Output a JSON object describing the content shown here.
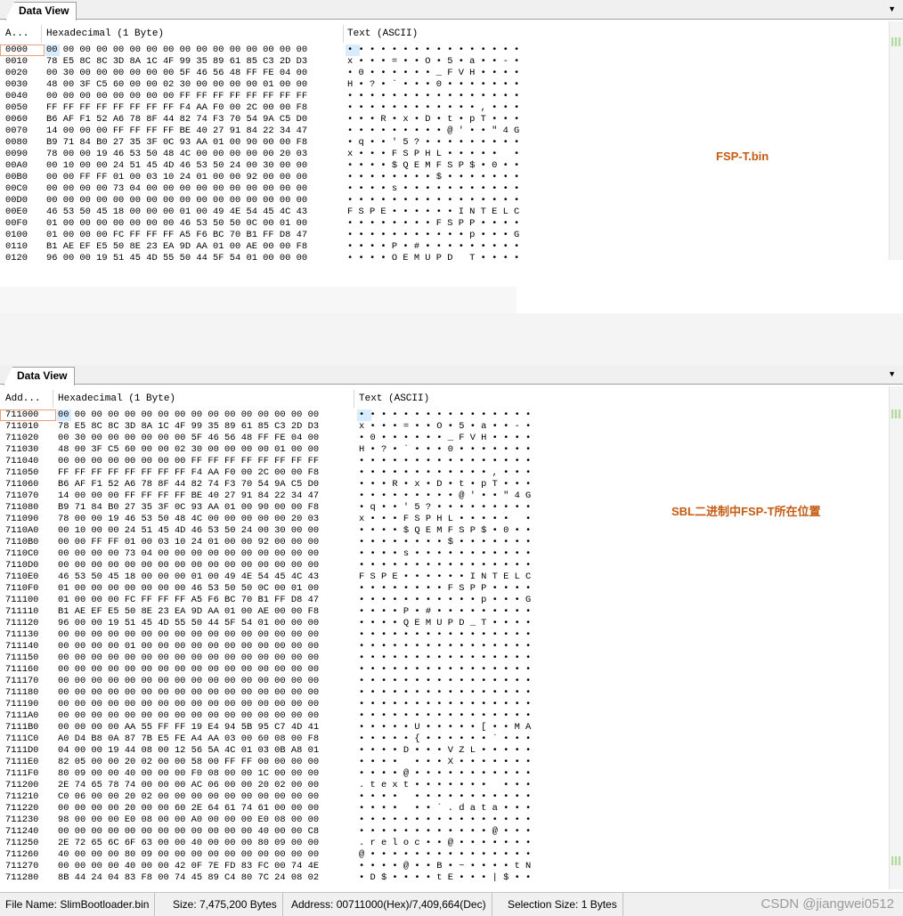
{
  "top": {
    "tab_label": "Data View",
    "headers": {
      "address": "A...",
      "hex": "Hexadecimal (1 Byte)",
      "text": "Text (ASCII)"
    },
    "note": "FSP-T.bin",
    "rows": [
      {
        "addr": "0000",
        "hex": "00 00 00 00 00 00 00 00 00 00 00 00 00 00 00 00",
        "ascii": "• • • • • • • • • • • • • • • •"
      },
      {
        "addr": "0010",
        "hex": "78 E5 8C 8C 3D 8A 1C 4F 99 35 89 61 85 C3 2D D3",
        "ascii": "x • • • = • • O • 5 • a • • - •"
      },
      {
        "addr": "0020",
        "hex": "00 30 00 00 00 00 00 00 5F 46 56 48 FF FE 04 00",
        "ascii": "• 0 • • • • • • _ F V H • • • •"
      },
      {
        "addr": "0030",
        "hex": "48 00 3F C5 60 00 00 02 30 00 00 00 00 01 00 00",
        "ascii": "H • ? • ` • • • 0 • • • • • • •"
      },
      {
        "addr": "0040",
        "hex": "00 00 00 00 00 00 00 00 FF FF FF FF FF FF FF FF",
        "ascii": "• • • • • • • • • • • • • • • •"
      },
      {
        "addr": "0050",
        "hex": "FF FF FF FF FF FF FF FF F4 AA F0 00 2C 00 00 F8",
        "ascii": "• • • • • • • • • • • • , • • •"
      },
      {
        "addr": "0060",
        "hex": "B6 AF F1 52 A6 78 8F 44 82 74 F3 70 54 9A C5 D0",
        "ascii": "• • • R • x • D • t • p T • • •"
      },
      {
        "addr": "0070",
        "hex": "14 00 00 00 FF FF FF FF BE 40 27 91 84 22 34 47",
        "ascii": "• • • • • • • • • @ ' • • \" 4 G"
      },
      {
        "addr": "0080",
        "hex": "B9 71 84 B0 27 35 3F 0C 93 AA 01 00 90 00 00 F8",
        "ascii": "• q • • ' 5 ? • • • • • • • • •"
      },
      {
        "addr": "0090",
        "hex": "78 00 00 19 46 53 50 48 4C 00 00 00 00 00 20 03",
        "ascii": "x • • • F S P H L • • • • •   •"
      },
      {
        "addr": "00A0",
        "hex": "00 10 00 00 24 51 45 4D 46 53 50 24 00 30 00 00",
        "ascii": "• • • • $ Q E M F S P $ • 0 • •"
      },
      {
        "addr": "00B0",
        "hex": "00 00 FF FF 01 00 03 10 24 01 00 00 92 00 00 00",
        "ascii": "• • • • • • • • $ • • • • • • •"
      },
      {
        "addr": "00C0",
        "hex": "00 00 00 00 73 04 00 00 00 00 00 00 00 00 00 00",
        "ascii": "• • • • s • • • • • • • • • • •"
      },
      {
        "addr": "00D0",
        "hex": "00 00 00 00 00 00 00 00 00 00 00 00 00 00 00 00",
        "ascii": "• • • • • • • • • • • • • • • •"
      },
      {
        "addr": "00E0",
        "hex": "46 53 50 45 18 00 00 00 01 00 49 4E 54 45 4C 43",
        "ascii": "F S P E • • • • • • I N T E L C"
      },
      {
        "addr": "00F0",
        "hex": "01 00 00 00 00 00 00 00 46 53 50 50 0C 00 01 00",
        "ascii": "• • • • • • • • F S P P • • • •"
      },
      {
        "addr": "0100",
        "hex": "01 00 00 00 FC FF FF FF A5 F6 BC 70 B1 FF D8 47",
        "ascii": "• • • • • • • • • • • p • • • G"
      },
      {
        "addr": "0110",
        "hex": "B1 AE EF E5 50 8E 23 EA 9D AA 01 00 AE 00 00 F8",
        "ascii": "• • • • P • # • • • • • • • • •"
      },
      {
        "addr": "0120",
        "hex": "96 00 00 19 51 45 4D 55 50 44 5F 54 01 00 00 00",
        "ascii": "• • • • Q E M U P D _ T • • • •"
      }
    ]
  },
  "bottom": {
    "tab_label": "Data View",
    "headers": {
      "address": "Add...",
      "hex": "Hexadecimal (1 Byte)",
      "text": "Text (ASCII)"
    },
    "note": "SBL二进制中FSP-T所在位置",
    "rows": [
      {
        "addr": "711000",
        "hex": "00 00 00 00 00 00 00 00 00 00 00 00 00 00 00 00",
        "ascii": "• • • • • • • • • • • • • • • •"
      },
      {
        "addr": "711010",
        "hex": "78 E5 8C 8C 3D 8A 1C 4F 99 35 89 61 85 C3 2D D3",
        "ascii": "x • • • = • • O • 5 • a • • - •"
      },
      {
        "addr": "711020",
        "hex": "00 30 00 00 00 00 00 00 5F 46 56 48 FF FE 04 00",
        "ascii": "• 0 • • • • • • _ F V H • • • •"
      },
      {
        "addr": "711030",
        "hex": "48 00 3F C5 60 00 00 02 30 00 00 00 00 01 00 00",
        "ascii": "H • ? • ` • • • 0 • • • • • • •"
      },
      {
        "addr": "711040",
        "hex": "00 00 00 00 00 00 00 00 FF FF FF FF FF FF FF FF",
        "ascii": "• • • • • • • • • • • • • • • •"
      },
      {
        "addr": "711050",
        "hex": "FF FF FF FF FF FF FF FF F4 AA F0 00 2C 00 00 F8",
        "ascii": "• • • • • • • • • • • • , • • •"
      },
      {
        "addr": "711060",
        "hex": "B6 AF F1 52 A6 78 8F 44 82 74 F3 70 54 9A C5 D0",
        "ascii": "• • • R • x • D • t • p T • • •"
      },
      {
        "addr": "711070",
        "hex": "14 00 00 00 FF FF FF FF BE 40 27 91 84 22 34 47",
        "ascii": "• • • • • • • • • @ ' • • \" 4 G"
      },
      {
        "addr": "711080",
        "hex": "B9 71 84 B0 27 35 3F 0C 93 AA 01 00 90 00 00 F8",
        "ascii": "• q • • ' 5 ? • • • • • • • • •"
      },
      {
        "addr": "711090",
        "hex": "78 00 00 19 46 53 50 48 4C 00 00 00 00 00 20 03",
        "ascii": "x • • • F S P H L • • • • •   •"
      },
      {
        "addr": "7110A0",
        "hex": "00 10 00 00 24 51 45 4D 46 53 50 24 00 30 00 00",
        "ascii": "• • • • $ Q E M F S P $ • 0 • •"
      },
      {
        "addr": "7110B0",
        "hex": "00 00 FF FF 01 00 03 10 24 01 00 00 92 00 00 00",
        "ascii": "• • • • • • • • $ • • • • • • •"
      },
      {
        "addr": "7110C0",
        "hex": "00 00 00 00 73 04 00 00 00 00 00 00 00 00 00 00",
        "ascii": "• • • • s • • • • • • • • • • •"
      },
      {
        "addr": "7110D0",
        "hex": "00 00 00 00 00 00 00 00 00 00 00 00 00 00 00 00",
        "ascii": "• • • • • • • • • • • • • • • •"
      },
      {
        "addr": "7110E0",
        "hex": "46 53 50 45 18 00 00 00 01 00 49 4E 54 45 4C 43",
        "ascii": "F S P E • • • • • • I N T E L C"
      },
      {
        "addr": "7110F0",
        "hex": "01 00 00 00 00 00 00 00 46 53 50 50 0C 00 01 00",
        "ascii": "• • • • • • • • F S P P • • • •"
      },
      {
        "addr": "711100",
        "hex": "01 00 00 00 FC FF FF FF A5 F6 BC 70 B1 FF D8 47",
        "ascii": "• • • • • • • • • • • p • • • G"
      },
      {
        "addr": "711110",
        "hex": "B1 AE EF E5 50 8E 23 EA 9D AA 01 00 AE 00 00 F8",
        "ascii": "• • • • P • # • • • • • • • • •"
      },
      {
        "addr": "711120",
        "hex": "96 00 00 19 51 45 4D 55 50 44 5F 54 01 00 00 00",
        "ascii": "• • • • Q E M U P D _ T • • • •"
      },
      {
        "addr": "711130",
        "hex": "00 00 00 00 00 00 00 00 00 00 00 00 00 00 00 00",
        "ascii": "• • • • • • • • • • • • • • • •"
      },
      {
        "addr": "711140",
        "hex": "00 00 00 00 01 00 00 00 00 00 00 00 00 00 00 00",
        "ascii": "• • • • • • • • • • • • • • • •"
      },
      {
        "addr": "711150",
        "hex": "00 00 00 00 00 00 00 00 00 00 00 00 00 00 00 00",
        "ascii": "• • • • • • • • • • • • • • • •"
      },
      {
        "addr": "711160",
        "hex": "00 00 00 00 00 00 00 00 00 00 00 00 00 00 00 00",
        "ascii": "• • • • • • • • • • • • • • • •"
      },
      {
        "addr": "711170",
        "hex": "00 00 00 00 00 00 00 00 00 00 00 00 00 00 00 00",
        "ascii": "• • • • • • • • • • • • • • • •"
      },
      {
        "addr": "711180",
        "hex": "00 00 00 00 00 00 00 00 00 00 00 00 00 00 00 00",
        "ascii": "• • • • • • • • • • • • • • • •"
      },
      {
        "addr": "711190",
        "hex": "00 00 00 00 00 00 00 00 00 00 00 00 00 00 00 00",
        "ascii": "• • • • • • • • • • • • • • • •"
      },
      {
        "addr": "7111A0",
        "hex": "00 00 00 00 00 00 00 00 00 00 00 00 00 00 00 00",
        "ascii": "• • • • • • • • • • • • • • • •"
      },
      {
        "addr": "7111B0",
        "hex": "00 00 00 00 AA 55 FF FF 19 E4 94 5B 95 C7 4D 41",
        "ascii": "• • • • • U • • • • • [ • • M A"
      },
      {
        "addr": "7111C0",
        "hex": "A0 D4 B8 0A 87 7B E5 FE A4 AA 03 00 60 08 00 F8",
        "ascii": "• • • • • { • • • • • • ` • • •"
      },
      {
        "addr": "7111D0",
        "hex": "04 00 00 19 44 08 00 12 56 5A 4C 01 03 0B A8 01",
        "ascii": "• • • • D • • • V Z L • • • • •"
      },
      {
        "addr": "7111E0",
        "hex": "82 05 00 00 20 02 00 00 58 00 FF FF 00 00 00 00",
        "ascii": "• • • •   • • • X • • • • • • •"
      },
      {
        "addr": "7111F0",
        "hex": "80 09 00 00 40 00 00 00 F0 08 00 00 1C 00 00 00",
        "ascii": "• • • • @ • • • • • • • • • • •"
      },
      {
        "addr": "711200",
        "hex": "2E 74 65 78 74 00 00 00 AC 06 00 00 20 02 00 00",
        "ascii": ". t e x t • • • • • • •   • • •"
      },
      {
        "addr": "711210",
        "hex": "C0 06 00 00 20 02 00 00 00 00 00 00 00 00 00 00",
        "ascii": "• • • •   • • • • • • • • • • •"
      },
      {
        "addr": "711220",
        "hex": "00 00 00 00 20 00 00 60 2E 64 61 74 61 00 00 00",
        "ascii": "• • • •   • • ` . d a t a • • •"
      },
      {
        "addr": "711230",
        "hex": "98 00 00 00 E0 08 00 00 A0 00 00 00 E0 08 00 00",
        "ascii": "• • • • • • • • • • • • • • • •"
      },
      {
        "addr": "711240",
        "hex": "00 00 00 00 00 00 00 00 00 00 00 00 40 00 00 C8",
        "ascii": "• • • • • • • • • • • • @ • • •"
      },
      {
        "addr": "711250",
        "hex": "2E 72 65 6C 6F 63 00 00 40 00 00 00 80 09 00 00",
        "ascii": ". r e l o c • • @ • • • • • • •"
      },
      {
        "addr": "711260",
        "hex": "40 00 00 00 80 09 00 00 00 00 00 00 00 00 00 00",
        "ascii": "@ • • • • • • • • • • • • • • •"
      },
      {
        "addr": "711270",
        "hex": "00 00 00 00 40 00 00 42 0F 7E FD 83 FC 00 74 4E",
        "ascii": "• • • • @ • • B • ~ • • • • t N"
      },
      {
        "addr": "711280",
        "hex": "8B 44 24 04 83 F8 00 74 45 89 C4 80 7C 24 08 02",
        "ascii": "• D $ • • • • t E • • • | $ • •"
      }
    ]
  },
  "status": {
    "file_name": "File Name: SlimBootloader.bin",
    "size": "Size: 7,475,200 Bytes",
    "address": "Address: 00711000(Hex)/7,409,664(Dec)",
    "selection": "Selection Size: 1 Bytes",
    "watermark": "CSDN @jiangwei0512"
  },
  "colors": {
    "note": "#c55a11",
    "selection_border": "#e8a17a",
    "selection_fill": "#cde8ff"
  }
}
